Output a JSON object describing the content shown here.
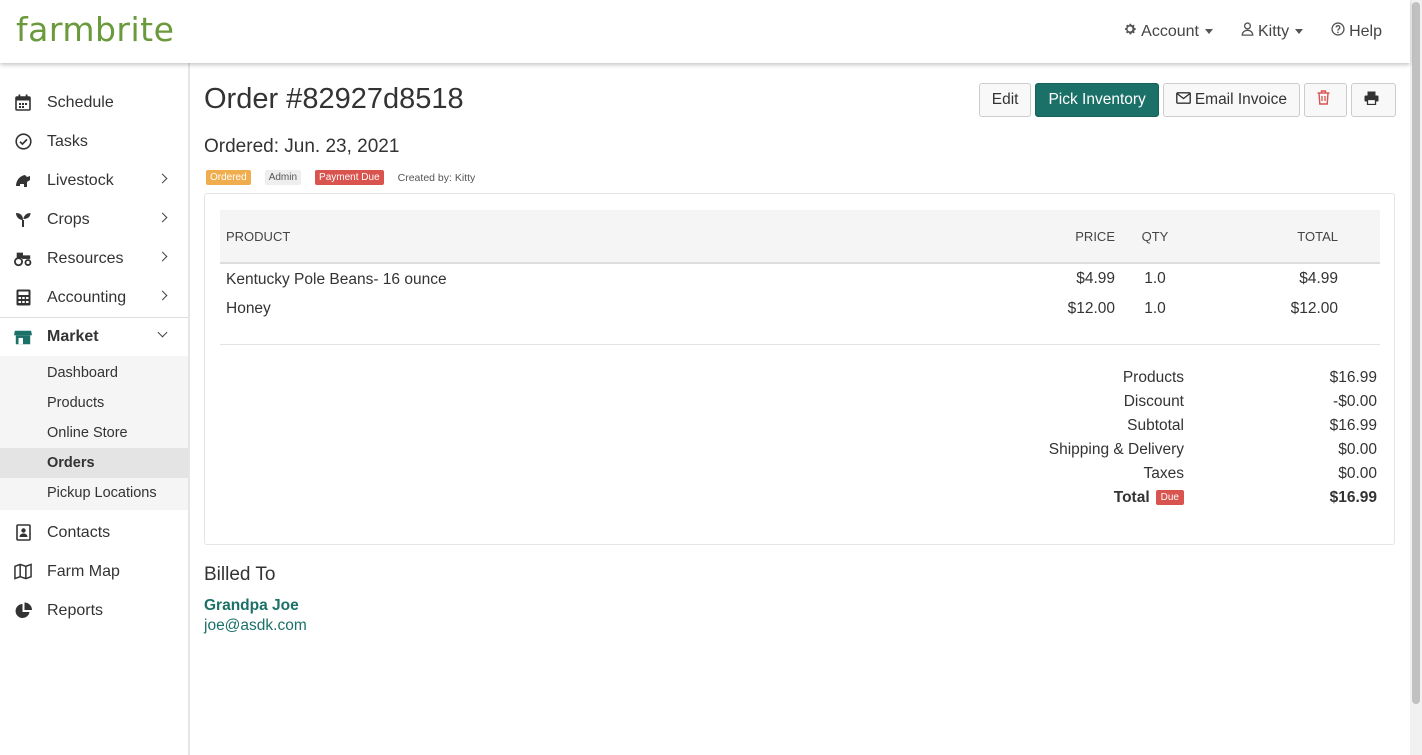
{
  "app": {
    "logo": "farmbrite"
  },
  "topnav": {
    "account": "Account",
    "user": "Kitty",
    "help": "Help"
  },
  "sidebar": {
    "items": [
      {
        "label": "Schedule"
      },
      {
        "label": "Tasks"
      },
      {
        "label": "Livestock"
      },
      {
        "label": "Crops"
      },
      {
        "label": "Resources"
      },
      {
        "label": "Accounting"
      },
      {
        "label": "Market"
      },
      {
        "label": "Contacts"
      },
      {
        "label": "Farm Map"
      },
      {
        "label": "Reports"
      }
    ],
    "market_sub": [
      {
        "label": "Dashboard"
      },
      {
        "label": "Products"
      },
      {
        "label": "Online Store"
      },
      {
        "label": "Orders"
      },
      {
        "label": "Pickup Locations"
      }
    ]
  },
  "order": {
    "title": "Order #82927d8518",
    "ordered": "Ordered: Jun. 23, 2021",
    "tags": {
      "status": "Ordered",
      "source": "Admin",
      "payment": "Payment Due"
    },
    "created_by": "Created by: Kitty"
  },
  "actions": {
    "edit": "Edit",
    "pick": "Pick Inventory",
    "email": "Email Invoice"
  },
  "table": {
    "headers": {
      "product": "PRODUCT",
      "price": "PRICE",
      "qty": "QTY",
      "total": "TOTAL"
    },
    "rows": [
      {
        "product": "Kentucky Pole Beans- 16 ounce",
        "price": "$4.99",
        "qty": "1.0",
        "total": "$4.99"
      },
      {
        "product": "Honey",
        "price": "$12.00",
        "qty": "1.0",
        "total": "$12.00"
      }
    ]
  },
  "summary": {
    "products_label": "Products",
    "products": "$16.99",
    "discount_label": "Discount",
    "discount": "-$0.00",
    "subtotal_label": "Subtotal",
    "subtotal": "$16.99",
    "shipping_label": "Shipping & Delivery",
    "shipping": "$0.00",
    "taxes_label": "Taxes",
    "taxes": "$0.00",
    "total_label": "Total",
    "total_badge": "Due",
    "total": "$16.99"
  },
  "billing": {
    "title": "Billed To",
    "name": "Grandpa Joe",
    "email": "joe@asdk.com"
  },
  "colors": {
    "brand_green": "#6a9a3b",
    "primary_teal": "#1b7068",
    "danger": "#d9534f",
    "warning": "#f0ad4e"
  }
}
